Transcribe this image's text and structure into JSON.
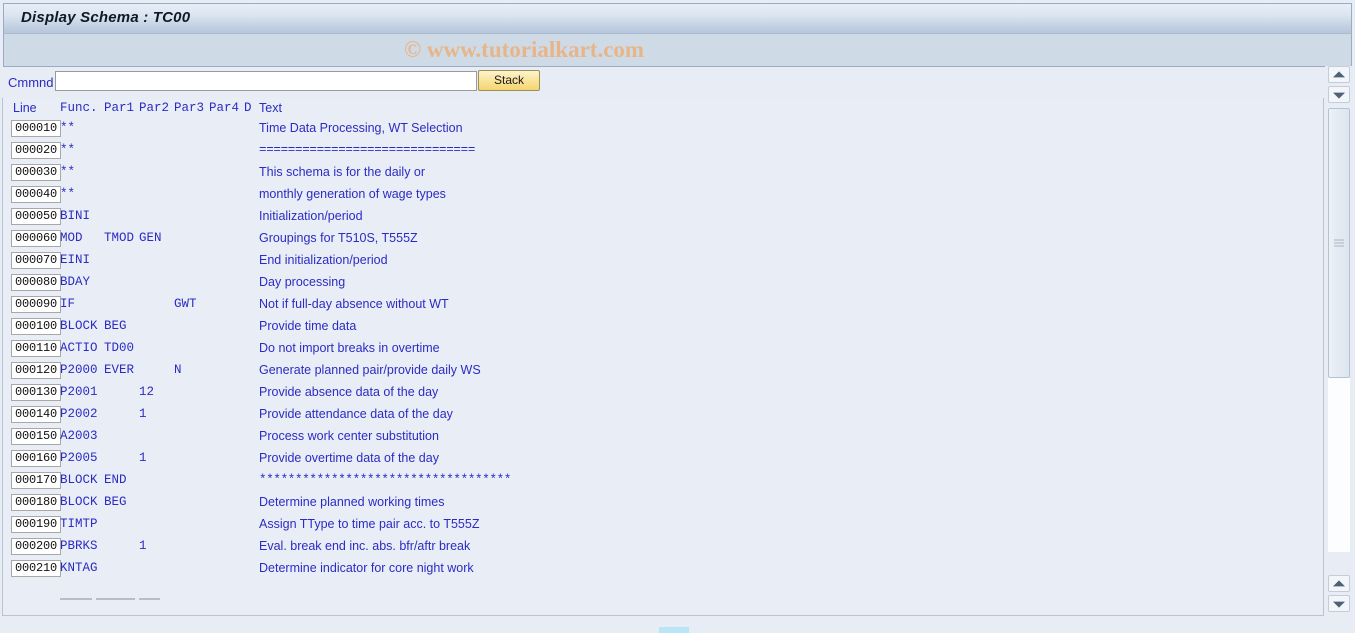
{
  "window": {
    "title": "Display Schema : TC00",
    "watermark": "© www.tutorialkart.com"
  },
  "command_row": {
    "label": "Cmmnd",
    "input_value": "",
    "input_placeholder": "",
    "stack_label": "Stack"
  },
  "table": {
    "headers": {
      "line": "Line",
      "func": "Func.",
      "par1": "Par1",
      "par2": "Par2",
      "par3": "Par3",
      "par4": "Par4",
      "d": "D",
      "text": "Text"
    },
    "rows": [
      {
        "line": "000010",
        "func": "**",
        "par1": "",
        "par2": "",
        "par3": "",
        "par4": "",
        "d": "",
        "text": "Time Data Processing, WT Selection",
        "mono": false
      },
      {
        "line": "000020",
        "func": "**",
        "par1": "",
        "par2": "",
        "par3": "",
        "par4": "",
        "d": "",
        "text": "============================== ",
        "mono": true
      },
      {
        "line": "000030",
        "func": "**",
        "par1": "",
        "par2": "",
        "par3": "",
        "par4": "",
        "d": "",
        "text": "This schema is for the daily or",
        "mono": false
      },
      {
        "line": "000040",
        "func": "**",
        "par1": "",
        "par2": "",
        "par3": "",
        "par4": "",
        "d": "",
        "text": "monthly generation of wage types",
        "mono": false
      },
      {
        "line": "000050",
        "func": "BINI",
        "par1": "",
        "par2": "",
        "par3": "",
        "par4": "",
        "d": "",
        "text": "Initialization/period",
        "mono": false
      },
      {
        "line": "000060",
        "func": "MOD",
        "par1": "TMOD",
        "par2": "GEN",
        "par3": "",
        "par4": "",
        "d": "",
        "text": "Groupings for T510S, T555Z",
        "mono": false
      },
      {
        "line": "000070",
        "func": "EINI",
        "par1": "",
        "par2": "",
        "par3": "",
        "par4": "",
        "d": "",
        "text": "End initialization/period",
        "mono": false
      },
      {
        "line": "000080",
        "func": "BDAY",
        "par1": "",
        "par2": "",
        "par3": "",
        "par4": "",
        "d": "",
        "text": "Day processing",
        "mono": false
      },
      {
        "line": "000090",
        "func": "IF",
        "par1": "",
        "par2": "",
        "par3": "GWT",
        "par4": "",
        "d": "",
        "text": "Not if full-day absence without WT",
        "mono": false
      },
      {
        "line": "000100",
        "func": "BLOCK",
        "par1": "BEG",
        "par2": "",
        "par3": "",
        "par4": "",
        "d": "",
        "text": "Provide time data",
        "mono": false
      },
      {
        "line": "000110",
        "func": "ACTIO",
        "par1": "TD00",
        "par2": "",
        "par3": "",
        "par4": "",
        "d": "",
        "text": "Do not import breaks in overtime",
        "mono": false
      },
      {
        "line": "000120",
        "func": "P2000",
        "par1": "EVER",
        "par2": "",
        "par3": "N",
        "par4": "",
        "d": "",
        "text": "Generate planned pair/provide daily WS",
        "mono": false
      },
      {
        "line": "000130",
        "func": "P2001",
        "par1": "",
        "par2": "12",
        "par3": "",
        "par4": "",
        "d": "",
        "text": "Provide absence data of the day",
        "mono": false
      },
      {
        "line": "000140",
        "func": "P2002",
        "par1": "",
        "par2": "1",
        "par3": "",
        "par4": "",
        "d": "",
        "text": "Provide attendance data of the day",
        "mono": false
      },
      {
        "line": "000150",
        "func": "A2003",
        "par1": "",
        "par2": "",
        "par3": "",
        "par4": "",
        "d": "",
        "text": "Process work center substitution",
        "mono": false
      },
      {
        "line": "000160",
        "func": "P2005",
        "par1": "",
        "par2": "1",
        "par3": "",
        "par4": "",
        "d": "",
        "text": "Provide overtime data of the day",
        "mono": false
      },
      {
        "line": "000170",
        "func": "BLOCK",
        "par1": "END",
        "par2": "",
        "par3": "",
        "par4": "",
        "d": "",
        "text": "***********************************",
        "mono": true
      },
      {
        "line": "000180",
        "func": "BLOCK",
        "par1": "BEG",
        "par2": "",
        "par3": "",
        "par4": "",
        "d": "",
        "text": "Determine planned working times",
        "mono": false
      },
      {
        "line": "000190",
        "func": "TIMTP",
        "par1": "",
        "par2": "",
        "par3": "",
        "par4": "",
        "d": "",
        "text": "Assign TType to time pair acc. to T555Z",
        "mono": false
      },
      {
        "line": "000200",
        "func": "PBRKS",
        "par1": "",
        "par2": "1",
        "par3": "",
        "par4": "",
        "d": "",
        "text": "Eval. break end inc. abs. bfr/aftr break",
        "mono": false
      },
      {
        "line": "000210",
        "func": "KNTAG",
        "par1": "",
        "par2": "",
        "par3": "",
        "par4": "",
        "d": "",
        "text": "Determine indicator for core night work",
        "mono": false
      }
    ]
  },
  "scrollbar": {
    "up_icon": "triangle-up-icon",
    "down_icon": "triangle-down-icon",
    "bottom_up_icon": "triangle-up-icon",
    "bottom_down_icon": "triangle-down-icon"
  },
  "colors": {
    "titlebar_accent": "#b7c7dc",
    "field_text": "#2b2bc4",
    "watermark": "#e8b588",
    "stack_button": "#f4d570",
    "status_highlight": "#b9e6f7"
  }
}
